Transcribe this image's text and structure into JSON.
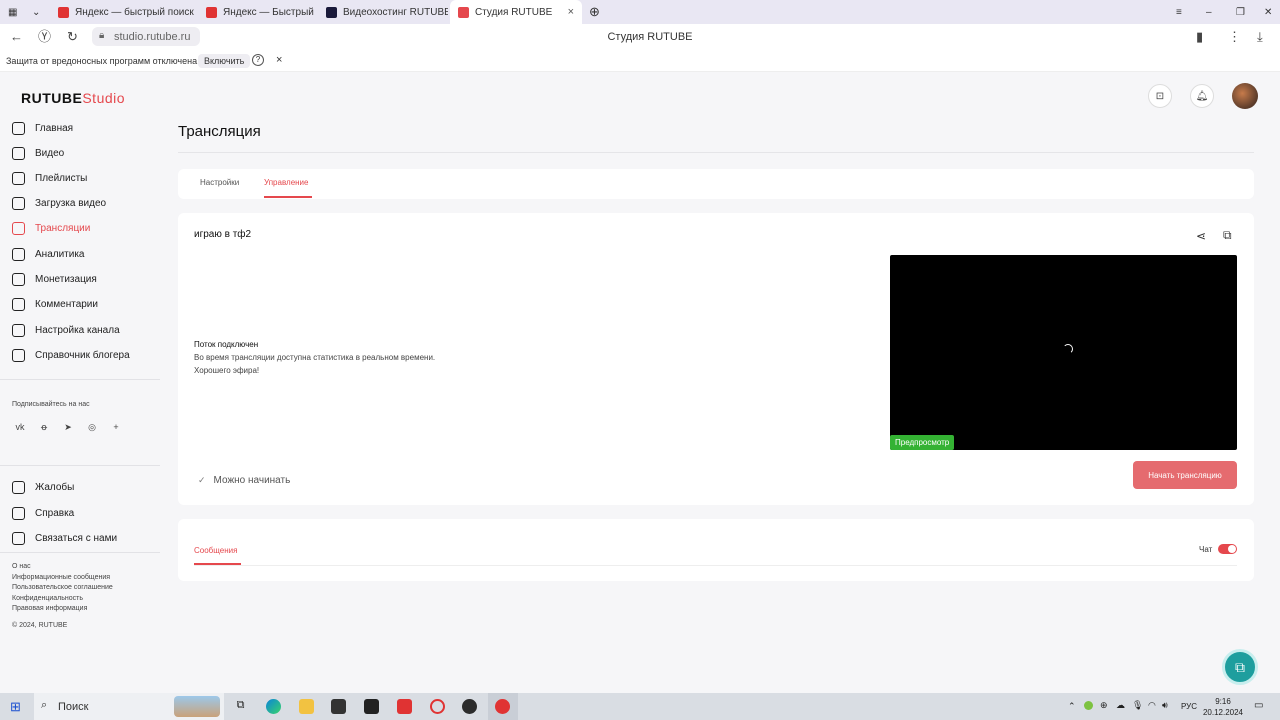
{
  "browser": {
    "tabs": [
      {
        "label": "Яндекс — быстрый поиск",
        "favicon_color": "#e03333"
      },
      {
        "label": "Яндекс — Быстрый поиск",
        "favicon_color": "#e03333"
      },
      {
        "label": "Видеохостинг RUTUBE. С",
        "favicon_color": "#1a1a3a"
      },
      {
        "label": "Студия RUTUBE",
        "favicon_color": "#e5484d"
      }
    ],
    "url": "studio.rutube.ru",
    "page_title": "Студия RUTUBE",
    "protection_text": "Защита от вредоносных программ отключена",
    "enable_label": "Включить",
    "help_glyph": "?",
    "close_glyph": "×"
  },
  "sidebar": {
    "logo_main": "RUTUBE",
    "logo_studio": "Studio",
    "nav": [
      {
        "label": "Главная",
        "icon": "home-icon"
      },
      {
        "label": "Видео",
        "icon": "video-icon"
      },
      {
        "label": "Плейлисты",
        "icon": "playlist-icon"
      },
      {
        "label": "Загрузка видео",
        "icon": "upload-icon"
      },
      {
        "label": "Трансляции",
        "icon": "broadcast-icon",
        "active": true
      },
      {
        "label": "Аналитика",
        "icon": "analytics-icon"
      },
      {
        "label": "Монетизация",
        "icon": "monetization-icon"
      },
      {
        "label": "Комментарии",
        "icon": "comments-icon"
      },
      {
        "label": "Настройка канала",
        "icon": "gear-icon"
      },
      {
        "label": "Справочник блогера",
        "icon": "info-icon"
      }
    ],
    "subscribe_title": "Подписывайтесь на нас",
    "socials": [
      "vk",
      "ok",
      "tg",
      "viber",
      "+"
    ],
    "support": [
      {
        "label": "Жалобы",
        "icon": "flag-icon"
      },
      {
        "label": "Справка",
        "icon": "help-icon"
      },
      {
        "label": "Связаться с нами",
        "icon": "mail-icon"
      }
    ],
    "footer_links": [
      "О нас",
      "Информационные сообщения",
      "Пользовательское соглашение",
      "Конфиденциальность",
      "Правовая информация"
    ],
    "copyright": "© 2024, RUTUBE"
  },
  "main": {
    "title": "Трансляция",
    "tabs": [
      {
        "label": "Настройки"
      },
      {
        "label": "Управление",
        "active": true
      }
    ],
    "stream": {
      "name": "играю в тф2",
      "status_title": "Поток подключен",
      "status_lines": [
        "Во время трансляции доступна статистика в реальном времени.",
        "Хорошего эфира!"
      ],
      "ready_label": "Можно начинать",
      "preview_label": "Предпросмотр",
      "start_button": "Начать трансляцию"
    },
    "messages": {
      "tab_label": "Сообщения",
      "chat_label": "Чат",
      "chat_enabled": true
    }
  },
  "taskbar": {
    "search_placeholder": "Поиск",
    "lang": "РУС",
    "time": "9:16",
    "date": "20.12.2024"
  }
}
